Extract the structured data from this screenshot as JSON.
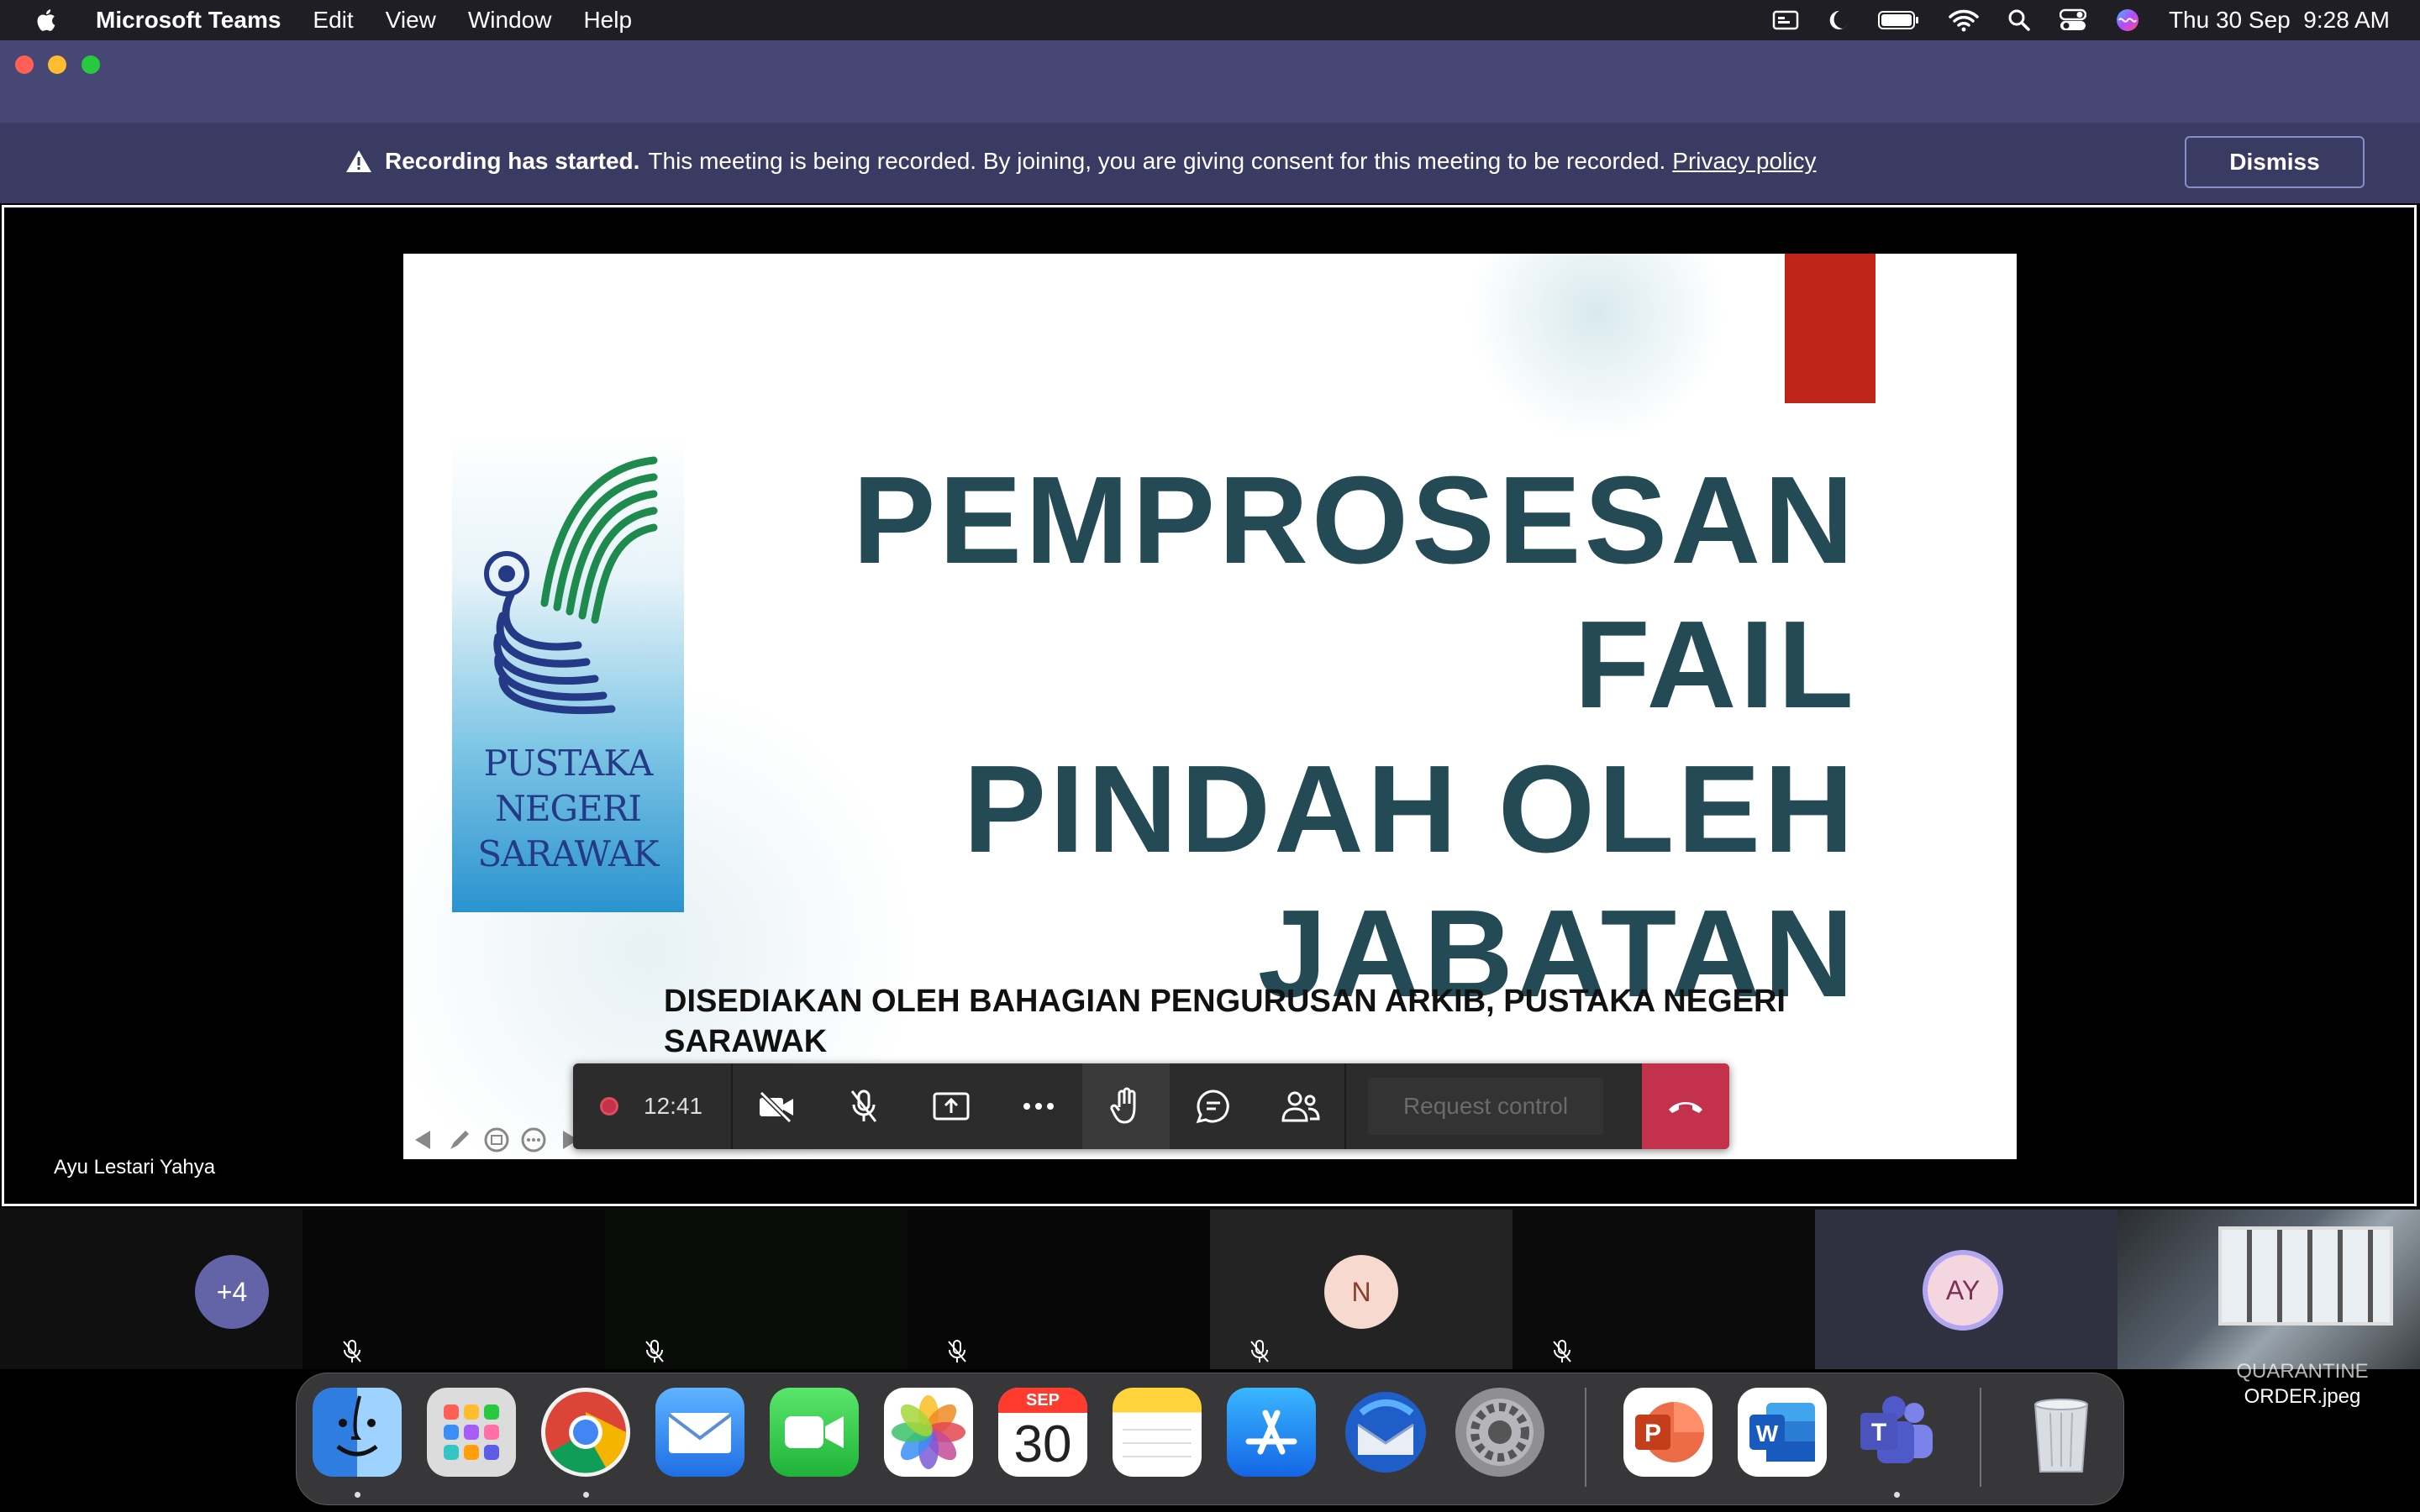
{
  "menubar": {
    "app_name": "Microsoft Teams",
    "menus": [
      "Edit",
      "View",
      "Window",
      "Help"
    ],
    "clock": "Thu 30 Sep  9:28 AM"
  },
  "banner": {
    "bold": "Recording has started.",
    "text": "This meeting is being recorded. By joining, you are giving consent for this meeting to be recorded.",
    "link": "Privacy policy",
    "dismiss": "Dismiss"
  },
  "slide": {
    "logo_lines": [
      "PUSTAKA",
      "NEGERI",
      "SARAWAK"
    ],
    "title_lines": [
      "PEMPROSESAN FAIL",
      "PINDAH OLEH",
      "JABATAN"
    ],
    "subtitle_lines": [
      "DISEDIAKAN OLEH BAHAGIAN PENGURUSAN ARKIB, PUSTAKA NEGERI",
      "SARAWAK"
    ]
  },
  "controls": {
    "duration": "12:41",
    "request_control": "Request control"
  },
  "presenter": "Ayu Lestari Yahya",
  "participants": {
    "overflow": "+4",
    "tile_n": "N",
    "tile_ay": "AY"
  },
  "desktop": {
    "file_label_line1": "QUARANTINE",
    "file_label_line2": "ORDER.jpeg"
  },
  "dock": {
    "calendar_month": "SEP",
    "calendar_day": "30"
  },
  "colors": {
    "teams_purple": "#464775",
    "banner": "#3a3b62",
    "slide_title": "#234a55",
    "hangup_red": "#c4314b"
  }
}
